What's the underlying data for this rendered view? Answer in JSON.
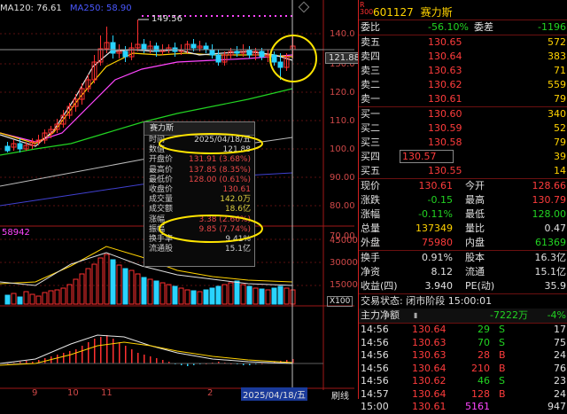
{
  "legend": {
    "ma120": "MA120: 76.61",
    "ma250": "MA250: 58.90"
  },
  "chart": {
    "high_marker": "149.56",
    "price_axis": [
      "140.0",
      "130.0",
      "120.0",
      "110.0",
      "100.0",
      "90.00",
      "80.00",
      "70.00"
    ],
    "current_price_tag": "121.88",
    "volume_left_label": "58942",
    "volume_axis": [
      "45000",
      "30000",
      "15000"
    ],
    "volume_unit": "X100",
    "date_labels": [
      "9",
      "10",
      "11",
      "2",
      "2025/04/18/五"
    ],
    "bottom_right_label": "刷线",
    "colors": {
      "up": "#ff3030",
      "down": "#29d3ff",
      "ma5": "#e8e8e8",
      "ma10": "#ffd200",
      "ma20": "#ff46ff",
      "ma60": "#22d322"
    }
  },
  "popup": {
    "title": "赛力斯",
    "rows": [
      {
        "k": "时间",
        "v": "2025/04/18/五",
        "c": ""
      },
      {
        "k": "数值",
        "v": "121.88",
        "c": ""
      },
      {
        "k": "开盘价",
        "v": "131.91 (3.68%)",
        "c": "red"
      },
      {
        "k": "最高价",
        "v": "137.85 (8.35%)",
        "c": "red"
      },
      {
        "k": "最低价",
        "v": "128.00 (0.61%)",
        "c": "red"
      },
      {
        "k": "收盘价",
        "v": "130.61",
        "c": "red"
      },
      {
        "k": "成交量",
        "v": "142.0万",
        "c": "yel"
      },
      {
        "k": "成交额",
        "v": "18.6亿",
        "c": "yel"
      },
      {
        "k": "涨幅",
        "v": "3.38 (2.66%)",
        "c": "red"
      },
      {
        "k": "振幅",
        "v": "9.85 (7.74%)",
        "c": "red"
      },
      {
        "k": "换手率",
        "v": "9.41%",
        "c": ""
      },
      {
        "k": "流通股",
        "v": "15.1亿",
        "c": ""
      }
    ]
  },
  "panel": {
    "rbadge": "R\n300",
    "code": "601127",
    "name": "赛力斯",
    "weibi_label": "委比",
    "weibi": "-56.10%",
    "weicha_label": "委差",
    "weicha": "-1196",
    "asks": [
      {
        "label": "卖五",
        "price": "130.65",
        "vol": "572"
      },
      {
        "label": "卖四",
        "price": "130.64",
        "vol": "383"
      },
      {
        "label": "卖三",
        "price": "130.63",
        "vol": "71"
      },
      {
        "label": "卖二",
        "price": "130.62",
        "vol": "559"
      },
      {
        "label": "卖一",
        "price": "130.61",
        "vol": "79"
      }
    ],
    "bids": [
      {
        "label": "买一",
        "price": "130.60",
        "vol": "340"
      },
      {
        "label": "买二",
        "price": "130.59",
        "vol": "52"
      },
      {
        "label": "买三",
        "price": "130.58",
        "vol": "79"
      },
      {
        "label": "买四",
        "price": "130.57",
        "vol": "39"
      },
      {
        "label": "买五",
        "price": "130.55",
        "vol": "14"
      }
    ],
    "stats": [
      {
        "l1": "现价",
        "v1": "130.61",
        "c1": "red",
        "l2": "今开",
        "v2": "128.66",
        "c2": "red"
      },
      {
        "l1": "涨跌",
        "v1": "-0.15",
        "c1": "grn",
        "l2": "最高",
        "v2": "130.79",
        "c2": "red"
      },
      {
        "l1": "涨幅",
        "v1": "-0.11%",
        "c1": "grn",
        "l2": "最低",
        "v2": "128.00",
        "c2": "grn"
      },
      {
        "l1": "总量",
        "v1": "137349",
        "c1": "yel",
        "l2": "量比",
        "v2": "0.47",
        "c2": "wht"
      },
      {
        "l1": "外盘",
        "v1": "75980",
        "c1": "red",
        "l2": "内盘",
        "v2": "61369",
        "c2": "grn"
      }
    ],
    "stats2": [
      {
        "l1": "换手",
        "v1": "0.91%",
        "l2": "股本",
        "v2": "16.3亿"
      },
      {
        "l1": "净资",
        "v1": "8.12",
        "l2": "流通",
        "v2": "15.1亿"
      },
      {
        "l1": "收益(四)",
        "v1": "3.940",
        "l2": "PE(动)",
        "v2": "35.9"
      }
    ],
    "trade_status": "交易状态: 闭市阶段 15:00:01",
    "main_flow_label": "主力净额",
    "main_flow_value": "-7222万",
    "main_flow_pct": "-4%",
    "trades": [
      {
        "t": "14:56",
        "p": "130.64",
        "v": "29",
        "s": "S",
        "n": "17"
      },
      {
        "t": "14:56",
        "p": "130.63",
        "v": "70",
        "s": "S",
        "n": "75"
      },
      {
        "t": "14:56",
        "p": "130.63",
        "v": "28",
        "s": "B",
        "n": "24"
      },
      {
        "t": "14:56",
        "p": "130.64",
        "v": "210",
        "s": "B",
        "n": "76"
      },
      {
        "t": "14:56",
        "p": "130.62",
        "v": "46",
        "s": "S",
        "n": "23"
      },
      {
        "t": "14:57",
        "p": "130.64",
        "v": "128",
        "s": "B",
        "n": "24"
      },
      {
        "t": "15:00",
        "p": "130.61",
        "v": "5161",
        "s": "",
        "n": "947"
      }
    ]
  }
}
